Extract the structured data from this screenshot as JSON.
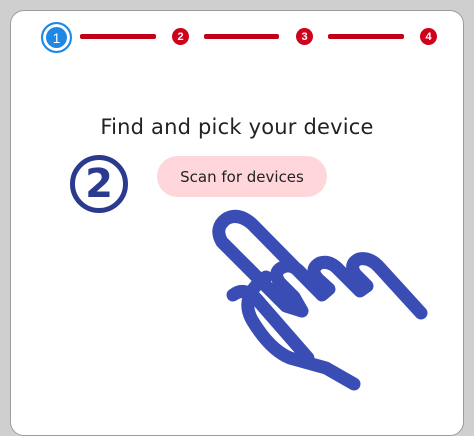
{
  "stepper": {
    "steps": [
      {
        "label": "1",
        "state": "active"
      },
      {
        "label": "2",
        "state": "pending"
      },
      {
        "label": "3",
        "state": "pending"
      },
      {
        "label": "4",
        "state": "pending"
      }
    ],
    "active_color": "#1e88e5",
    "pending_color": "#d0021b",
    "connector_color": "#c10015"
  },
  "main": {
    "heading": "Find and pick your device",
    "step_badge": "2",
    "scan_button_label": "Scan for devices"
  },
  "colors": {
    "badge": "#2a3a8f",
    "button_bg": "#ffd6da",
    "hand_icon": "#3a4db5"
  },
  "icons": {
    "hand": "pointing-hand-icon"
  }
}
